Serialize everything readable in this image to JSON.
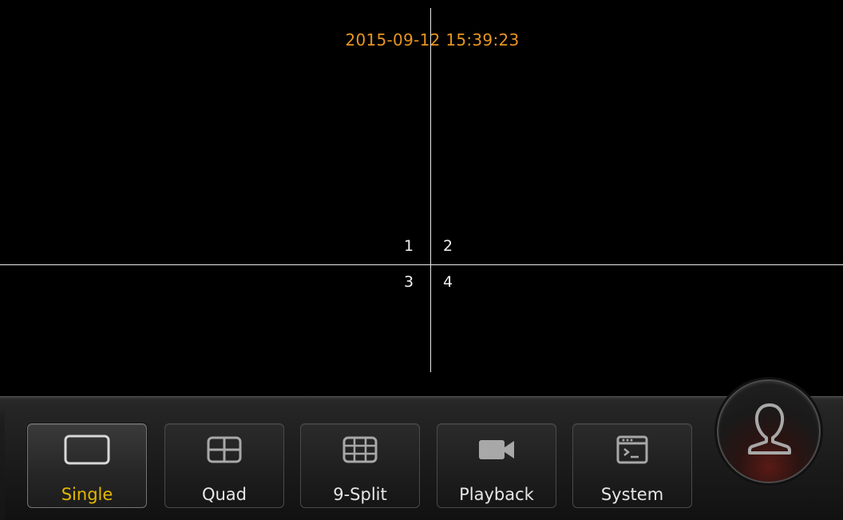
{
  "viewport": {
    "timestamp": "2015-09-12 15:39:23",
    "timestamp_color": "#e8951f",
    "channels": [
      "1",
      "2",
      "3",
      "4"
    ]
  },
  "toolbar": {
    "buttons": [
      {
        "label": "Single",
        "icon": "single-view-icon",
        "active": true
      },
      {
        "label": "Quad",
        "icon": "quad-view-icon",
        "active": false
      },
      {
        "label": "9-Split",
        "icon": "nine-split-icon",
        "active": false
      },
      {
        "label": "Playback",
        "icon": "video-camera-icon",
        "active": false
      },
      {
        "label": "System",
        "icon": "terminal-window-icon",
        "active": false
      }
    ],
    "active_label_color": "#e6b800",
    "user_icon": "user-icon"
  }
}
